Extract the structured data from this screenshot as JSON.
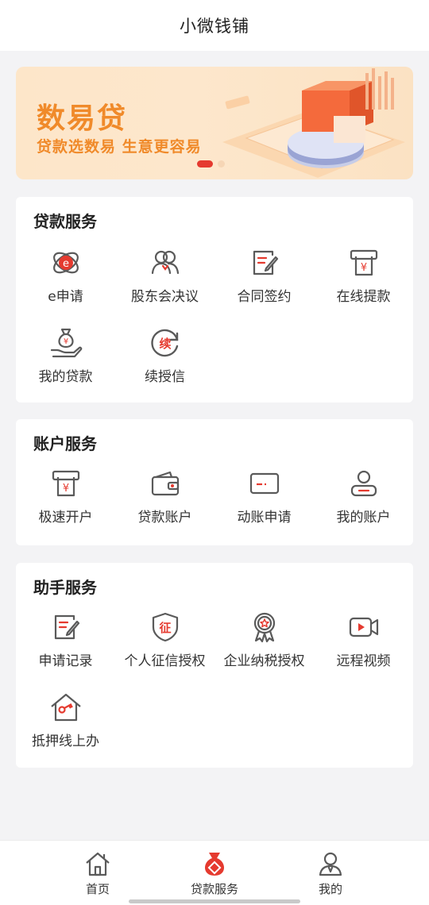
{
  "header": {
    "title": "小微钱铺"
  },
  "banner": {
    "title": "数易贷",
    "subtitle": "贷款选数易 生意更容易"
  },
  "sections": {
    "loan": {
      "title": "贷款服务",
      "items": [
        {
          "label": "e申请",
          "icon": "e-apply-icon"
        },
        {
          "label": "股东会决议",
          "icon": "shareholders-icon"
        },
        {
          "label": "合同签约",
          "icon": "contract-sign-icon"
        },
        {
          "label": "在线提款",
          "icon": "atm-withdraw-icon"
        },
        {
          "label": "我的贷款",
          "icon": "money-bag-hand-icon"
        },
        {
          "label": "续授信",
          "icon": "renew-credit-icon"
        }
      ]
    },
    "account": {
      "title": "账户服务",
      "items": [
        {
          "label": "极速开户",
          "icon": "atm-open-account-icon"
        },
        {
          "label": "贷款账户",
          "icon": "wallet-icon"
        },
        {
          "label": "动账申请",
          "icon": "card-icon"
        },
        {
          "label": "我的账户",
          "icon": "user-account-icon"
        }
      ]
    },
    "assistant": {
      "title": "助手服务",
      "items": [
        {
          "label": "申请记录",
          "icon": "record-icon"
        },
        {
          "label": "个人征信授权",
          "icon": "credit-shield-icon"
        },
        {
          "label": "企业纳税授权",
          "icon": "award-badge-icon"
        },
        {
          "label": "远程视频",
          "icon": "video-icon"
        },
        {
          "label": "抵押线上办",
          "icon": "house-key-icon"
        }
      ]
    }
  },
  "tabbar": {
    "tabs": [
      {
        "label": "首页",
        "icon": "home-icon"
      },
      {
        "label": "贷款服务",
        "icon": "money-bag-icon",
        "active": true
      },
      {
        "label": "我的",
        "icon": "profile-icon"
      }
    ]
  },
  "colors": {
    "accent": "#e53a2f",
    "icon_gray": "#5a5a5a",
    "banner_text": "#f08a2a"
  }
}
